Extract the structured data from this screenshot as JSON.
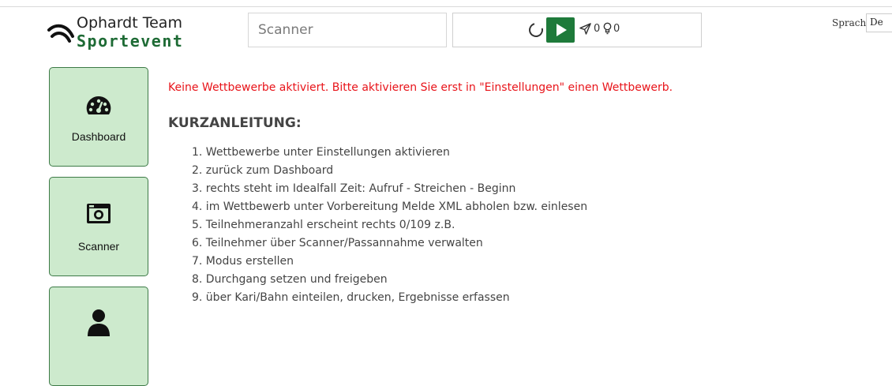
{
  "logo": {
    "line1": "Ophardt Team",
    "line2": "Sportevent"
  },
  "scanner": {
    "placeholder": "Scanner"
  },
  "controls": {
    "reload_icon": "reload-icon",
    "play_icon": "play-icon",
    "send_icon": "send-icon",
    "send_count": "0",
    "bulb_icon": "lightbulb-icon",
    "bulb_count": "0",
    "play_color": "#1e7a3a"
  },
  "language": {
    "label": "Sprache",
    "selected": "De"
  },
  "sidebar": {
    "tile_color": "#cdeacd",
    "items": [
      {
        "label": "Dashboard",
        "icon": "tachometer-icon"
      },
      {
        "label": "Scanner",
        "icon": "camera-icon"
      },
      {
        "label": "",
        "icon": "user-icon"
      }
    ]
  },
  "main": {
    "warning": "Keine Wettbewerbe aktiviert. Bitte aktivieren Sie erst in \"Einstellungen\" einen Wettbewerb.",
    "warning_color": "#e8141a",
    "heading": "KURZANLEITUNG:",
    "steps": [
      "1. Wettbewerbe unter Einstellungen aktivieren",
      "2. zurück zum Dashboard",
      "3. rechts steht im Idealfall Zeit: Aufruf - Streichen - Beginn",
      "4. im Wettbewerb unter Vorbereitung Melde XML abholen bzw. einlesen",
      "5. Teilnehmeranzahl erscheint rechts 0/109 z.B.",
      "6. Teilnehmer über Scanner/Passannahme verwalten",
      "7. Modus erstellen",
      "8. Durchgang setzen und freigeben",
      "9. über Kari/Bahn einteilen, drucken, Ergebnisse erfassen"
    ]
  }
}
